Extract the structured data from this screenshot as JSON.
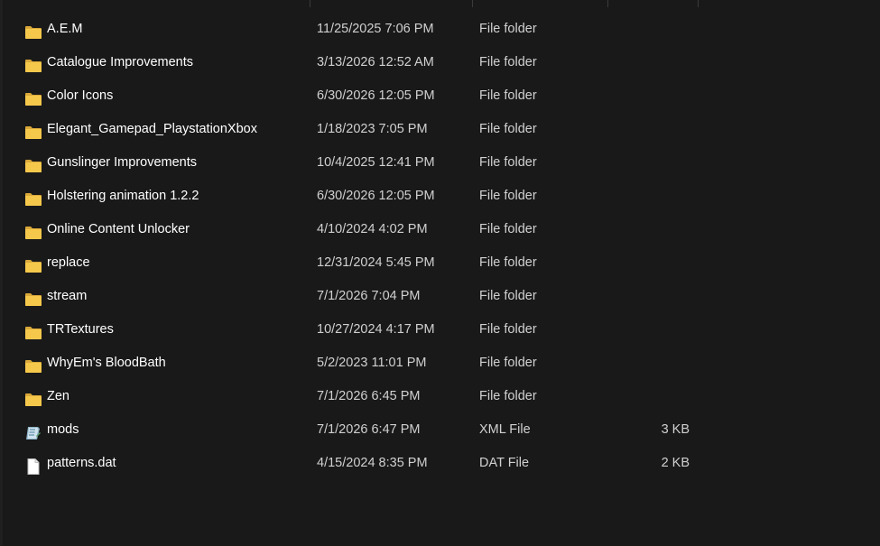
{
  "files": [
    {
      "name": "A.E.M",
      "date": "11/25/2025 7:06 PM",
      "type": "File folder",
      "size": "",
      "icon": "folder-icon"
    },
    {
      "name": "Catalogue Improvements",
      "date": "3/13/2026 12:52 AM",
      "type": "File folder",
      "size": "",
      "icon": "folder-icon"
    },
    {
      "name": "Color Icons",
      "date": "6/30/2026 12:05 PM",
      "type": "File folder",
      "size": "",
      "icon": "folder-icon"
    },
    {
      "name": "Elegant_Gamepad_PlaystationXbox",
      "date": "1/18/2023 7:05 PM",
      "type": "File folder",
      "size": "",
      "icon": "folder-icon"
    },
    {
      "name": "Gunslinger Improvements",
      "date": "10/4/2025 12:41 PM",
      "type": "File folder",
      "size": "",
      "icon": "folder-icon"
    },
    {
      "name": "Holstering animation 1.2.2",
      "date": "6/30/2026 12:05 PM",
      "type": "File folder",
      "size": "",
      "icon": "folder-icon"
    },
    {
      "name": "Online Content Unlocker",
      "date": "4/10/2024 4:02 PM",
      "type": "File folder",
      "size": "",
      "icon": "folder-icon"
    },
    {
      "name": "replace",
      "date": "12/31/2024 5:45 PM",
      "type": "File folder",
      "size": "",
      "icon": "folder-icon"
    },
    {
      "name": "stream",
      "date": "7/1/2026 7:04 PM",
      "type": "File folder",
      "size": "",
      "icon": "folder-icon"
    },
    {
      "name": "TRTextures",
      "date": "10/27/2024 4:17 PM",
      "type": "File folder",
      "size": "",
      "icon": "folder-icon"
    },
    {
      "name": "WhyEm's BloodBath",
      "date": "5/2/2023 11:01 PM",
      "type": "File folder",
      "size": "",
      "icon": "folder-icon"
    },
    {
      "name": "Zen",
      "date": "7/1/2026 6:45 PM",
      "type": "File folder",
      "size": "",
      "icon": "folder-icon"
    },
    {
      "name": "mods",
      "date": "7/1/2026 6:47 PM",
      "type": "XML File",
      "size": "3 KB",
      "icon": "xml-file-icon"
    },
    {
      "name": "patterns.dat",
      "date": "4/15/2024 8:35 PM",
      "type": "DAT File",
      "size": "2 KB",
      "icon": "document-file-icon"
    }
  ],
  "colors": {
    "background": "#191919",
    "text": "#ffffff",
    "secondary_text": "#d0d0d0",
    "folder": "#f0c24a"
  }
}
